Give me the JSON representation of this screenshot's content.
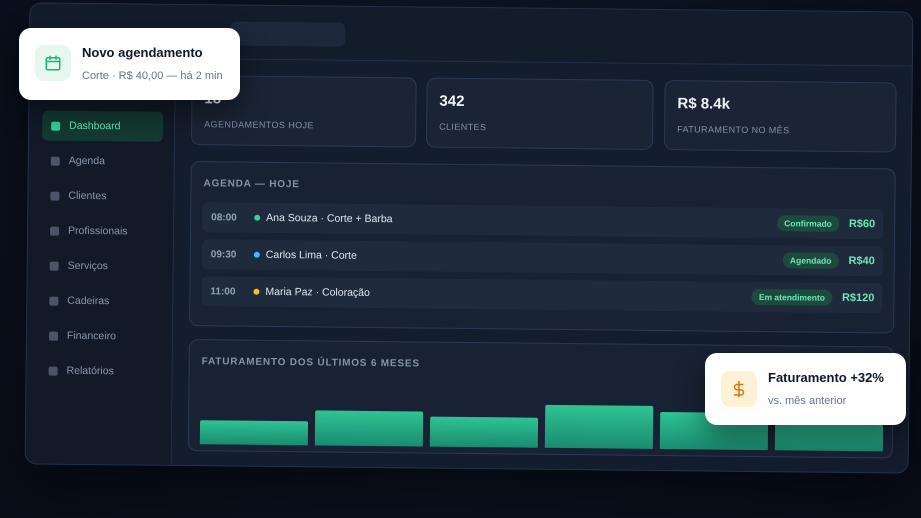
{
  "stats": [
    {
      "value": "18",
      "label": "AGENDAMENTOS HOJE"
    },
    {
      "value": "342",
      "label": "CLIENTES"
    },
    {
      "value": "R$ 8.4k",
      "label": "FATURAMENTO NO MÊS"
    }
  ],
  "sidebar": {
    "items": [
      {
        "label": "Dashboard",
        "active": true
      },
      {
        "label": "Agenda"
      },
      {
        "label": "Clientes"
      },
      {
        "label": "Profissionais"
      },
      {
        "label": "Serviços"
      },
      {
        "label": "Cadeiras"
      },
      {
        "label": "Financeiro"
      },
      {
        "label": "Relatórios"
      }
    ]
  },
  "agenda": {
    "title": "AGENDA — HOJE",
    "rows": [
      {
        "time": "08:00",
        "desc": "Ana Souza · Corte + Barba",
        "status": "Confirmado",
        "price": "R$60",
        "dot_color": "#34d399"
      },
      {
        "time": "09:30",
        "desc": "Carlos Lima · Corte",
        "status": "Agendado",
        "price": "R$40",
        "dot_color": "#38bdf8"
      },
      {
        "time": "11:00",
        "desc": "Maria Paz · Coloração",
        "status": "Em atendimento",
        "price": "R$120",
        "dot_color": "#fbbf24"
      }
    ]
  },
  "revenue": {
    "title": "FATURAMENTO DOS ÚLTIMOS 6 MESES",
    "levels": [
      0.5,
      0.72,
      0.62,
      0.9,
      0.78,
      0.68
    ]
  },
  "toast_new": {
    "title": "Novo agendamento",
    "subtitle": "Corte · R$ 40,00 — há 2 min",
    "icon": "calendar-icon"
  },
  "toast_revenue": {
    "title": "Faturamento +32%",
    "subtitle": "vs. mês anterior",
    "icon": "dollar-icon"
  },
  "colors": {
    "accent": "#34d399",
    "background": "#0b1220",
    "panel": "#182233"
  }
}
